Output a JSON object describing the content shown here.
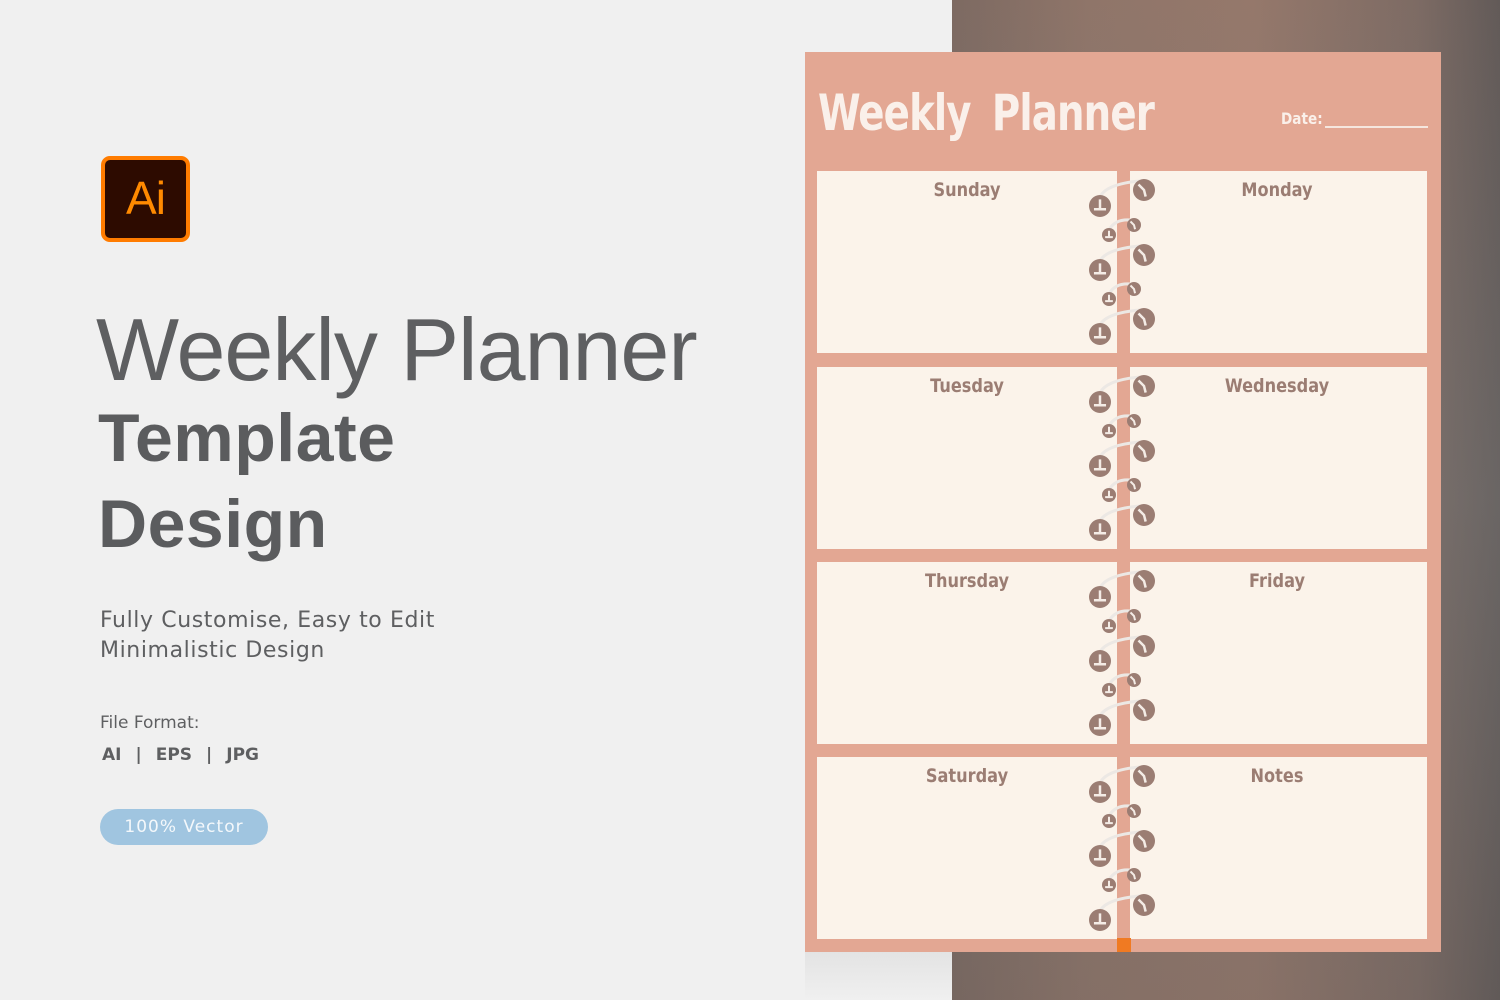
{
  "promo": {
    "app_badge": "Ai",
    "title_line1": "Weekly Planner",
    "title_line2": "Template",
    "title_line3": "Design",
    "subtitle_line1": "Fully Customise, Easy to Edit",
    "subtitle_line2": "Minimalistic Design",
    "file_format_label": "File Format:",
    "formats": [
      "AI",
      "EPS",
      "JPG"
    ],
    "format_separator": "|",
    "vector_badge": "100% Vector"
  },
  "planner": {
    "title": "Weekly  Planner",
    "date_label": "Date:",
    "cells": [
      {
        "label": "Sunday"
      },
      {
        "label": "Monday"
      },
      {
        "label": "Tuesday"
      },
      {
        "label": "Wednesday"
      },
      {
        "label": "Thursday"
      },
      {
        "label": "Friday"
      },
      {
        "label": "Saturday"
      },
      {
        "label": "Notes"
      }
    ]
  },
  "colors": {
    "background": "#f0f0f0",
    "text_gray": "#5b5c5e",
    "planner_frame": "#e3a793",
    "planner_cell": "#fbf3ea",
    "planner_label": "#9b7d73",
    "ring_color": "#9b7d73",
    "ai_orange": "#ff7c00",
    "ai_dark": "#2d0b00",
    "vector_badge": "#a0c5e0",
    "spine_marker": "#f07a22"
  }
}
